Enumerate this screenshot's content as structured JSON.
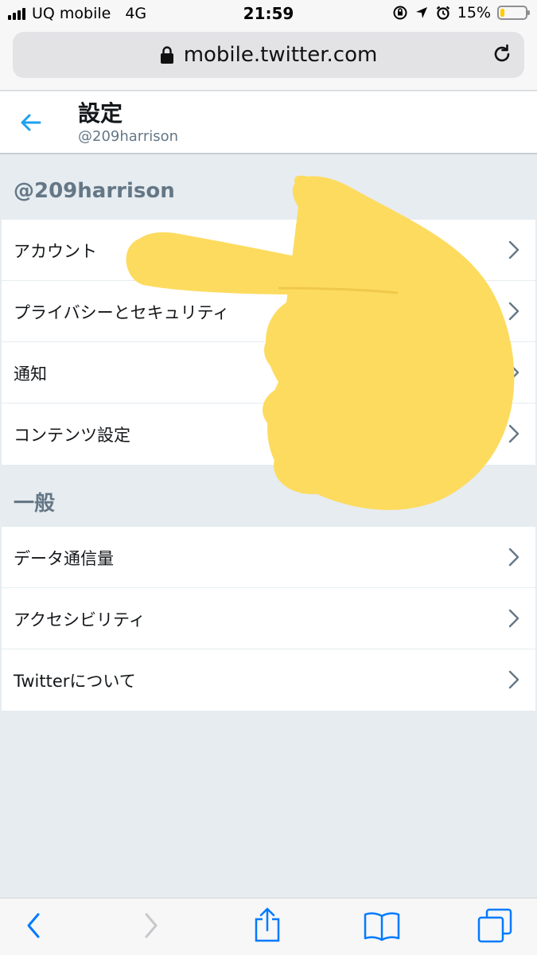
{
  "status_bar": {
    "carrier": "UQ mobile",
    "network": "4G",
    "time": "21:59",
    "battery_percent": "15%",
    "battery_level": 0.15,
    "battery_color": "#ffcc00"
  },
  "browser": {
    "url": "mobile.twitter.com"
  },
  "header": {
    "title": "設定",
    "username": "@209harrison"
  },
  "account_section": {
    "title": "@209harrison",
    "items": [
      {
        "label": "アカウント"
      },
      {
        "label": "プライバシーとセキュリティ"
      },
      {
        "label": "通知"
      },
      {
        "label": "コンテンツ設定"
      }
    ]
  },
  "general_section": {
    "title": "一般",
    "items": [
      {
        "label": "データ通信量"
      },
      {
        "label": "アクセシビリティ"
      },
      {
        "label": "Twitterについて"
      }
    ]
  },
  "colors": {
    "twitter_blue": "#1da1f2",
    "ios_blue": "#007aff",
    "hand_yellow": "#fddb5f",
    "background": "#e6ecf0"
  },
  "icons": {
    "back": "arrow-left-icon",
    "row": "chevron-right-icon",
    "overlay": "pointing-hand-emoji"
  }
}
